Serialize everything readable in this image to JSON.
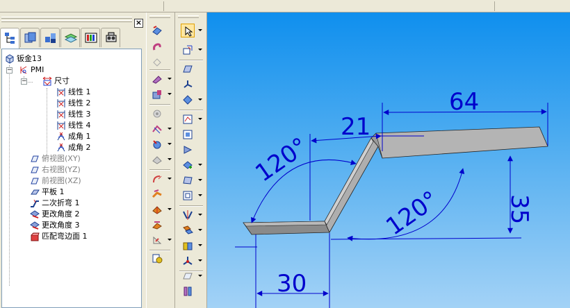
{
  "tree": {
    "items": [
      {
        "label": "钣金13",
        "icon": "sheetmetal-part-icon"
      },
      {
        "label": "PMI",
        "icon": "pmi-icon"
      },
      {
        "label": "尺寸",
        "icon": "dimension-folder-icon"
      },
      {
        "label": "线性 1",
        "icon": "linear-dimension-icon"
      },
      {
        "label": "线性 2",
        "icon": "linear-dimension-icon"
      },
      {
        "label": "线性 3",
        "icon": "linear-dimension-icon"
      },
      {
        "label": "线性 4",
        "icon": "linear-dimension-icon"
      },
      {
        "label": "成角 1",
        "icon": "angular-dimension-icon"
      },
      {
        "label": "成角 2",
        "icon": "angular-dimension-icon"
      },
      {
        "label": "俯视图(XY)",
        "icon": "plane-icon"
      },
      {
        "label": "右视图(YZ)",
        "icon": "plane-icon"
      },
      {
        "label": "前视图(XZ)",
        "icon": "plane-icon"
      },
      {
        "label": "平板 1",
        "icon": "tab-feature-icon"
      },
      {
        "label": "二次折弯 1",
        "icon": "jog-icon"
      },
      {
        "label": "更改角度 2",
        "icon": "change-angle-icon"
      },
      {
        "label": "更改角度 3",
        "icon": "change-angle-icon"
      },
      {
        "label": "匹配弯边面 1",
        "icon": "match-face-icon"
      }
    ]
  },
  "canvas": {
    "dim_64": "64",
    "dim_21": "21",
    "dim_35": "35",
    "dim_30": "30",
    "angle_left": "120°",
    "angle_right": "120°"
  },
  "colors": {
    "dimension": "#0000cc",
    "canvas_top": "#0f8fee",
    "canvas_bottom": "#a3d2f6",
    "part_face": "#b4b4b4"
  },
  "close_label": "×",
  "expand_minus": "−"
}
